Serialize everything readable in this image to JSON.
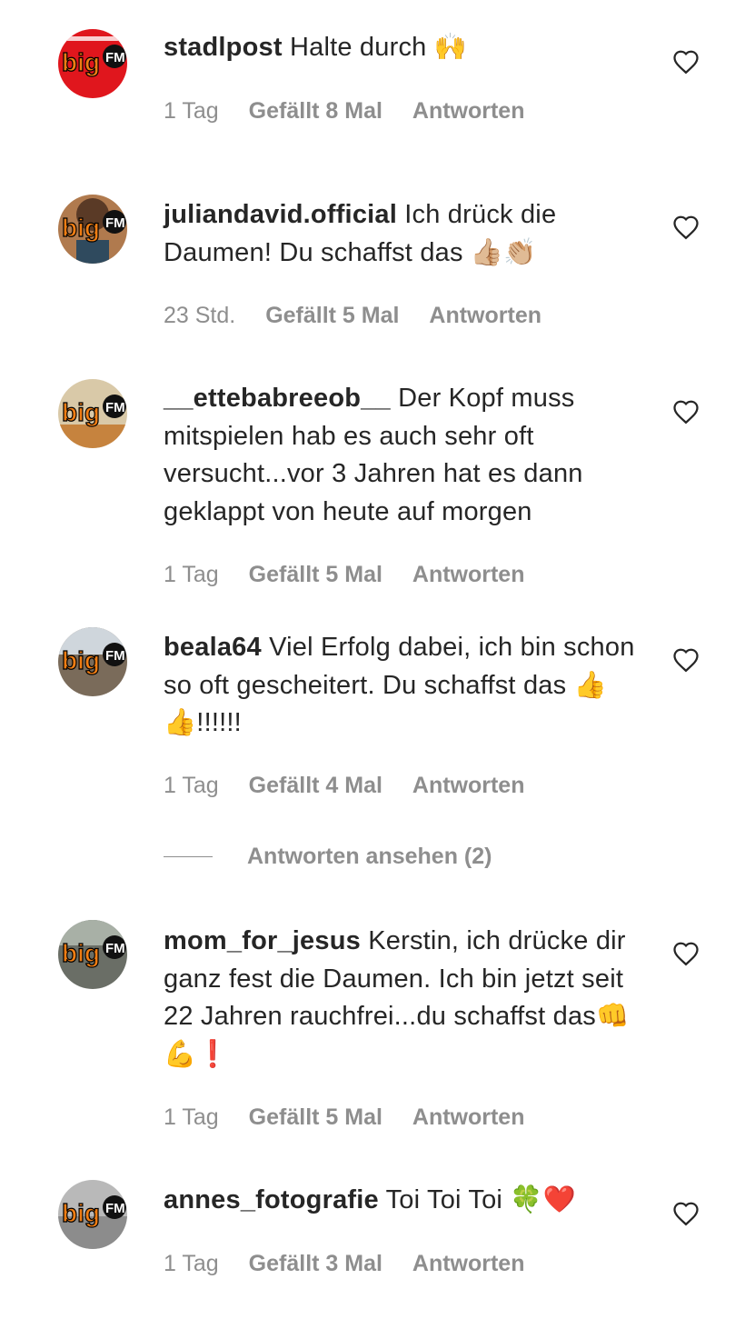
{
  "comments": [
    {
      "username": "stadlpost",
      "text": "Halte durch 🙌",
      "time": "1 Tag",
      "likes": "Gefällt 8 Mal",
      "reply": "Antworten",
      "avatar_bg": "#e0161d",
      "avatar_name": "bigfm-logo-avatar"
    },
    {
      "username": "juliandavid.official",
      "text": "Ich drück die Daumen! Du schaffst das 👍🏼👏🏼",
      "time": "23 Std.",
      "likes": "Gefällt 5 Mal",
      "reply": "Antworten",
      "avatar_bg": "#b07a4e",
      "avatar_name": "bigfm-logo-avatar"
    },
    {
      "username": "__ettebabreeob__",
      "text": "Der Kopf muss mitspielen hab es auch sehr oft versucht...vor 3 Jahren hat es dann geklappt von heute auf morgen",
      "time": "1 Tag",
      "likes": "Gefällt 5 Mal",
      "reply": "Antworten",
      "avatar_bg": "#d9c9a8",
      "avatar_name": "bigfm-logo-avatar"
    },
    {
      "username": "beala64",
      "text": "Viel Erfolg dabei, ich bin schon so oft gescheitert. Du schaffst das 👍👍!!!!!!",
      "time": "1 Tag",
      "likes": "Gefällt 4 Mal",
      "reply": "Antworten",
      "avatar_bg": "#7a6b5a",
      "avatar_name": "bigfm-logo-avatar"
    },
    {
      "username": "mom_for_jesus",
      "text": "Kerstin, ich drücke dir ganz fest die Daumen. Ich bin jetzt seit 22 Jahren rauchfrei...du schaffst das👊💪❗",
      "time": "1 Tag",
      "likes": "Gefällt 5 Mal",
      "reply": "Antworten",
      "avatar_bg": "#6a6e66",
      "avatar_name": "bigfm-logo-avatar"
    },
    {
      "username": "annes_fotografie",
      "text": "Toi Toi Toi 🍀❤️",
      "time": "1 Tag",
      "likes": "Gefällt 3 Mal",
      "reply": "Antworten",
      "avatar_bg": "#b9b9b9",
      "avatar_name": "bigfm-logo-avatar"
    }
  ],
  "view_replies": "Antworten ansehen (2)",
  "logo": {
    "big": "big",
    "fm": "FM"
  },
  "colors": {
    "meta": "#8e8e8e",
    "text": "#262626",
    "logo_orange": "#f07d13"
  },
  "icons": {
    "like": "heart-outline-icon"
  }
}
